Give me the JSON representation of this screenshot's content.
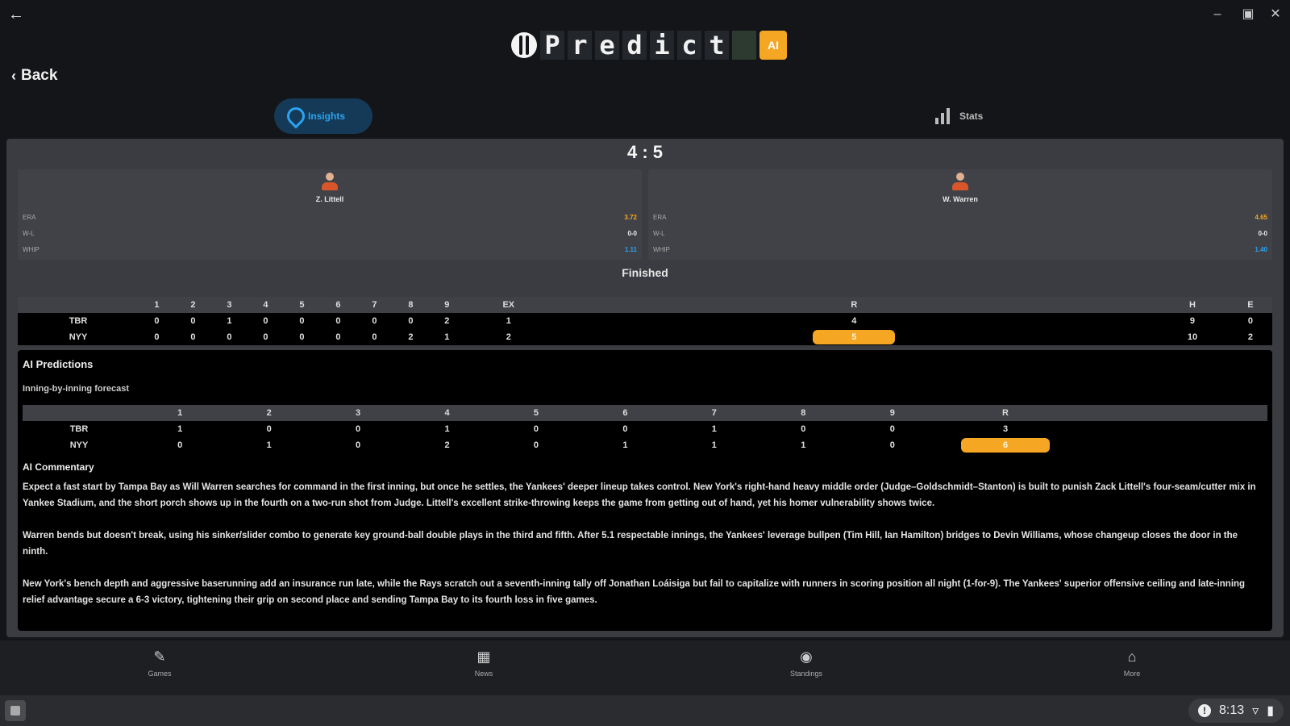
{
  "logo": {
    "letters": [
      "P",
      "r",
      "e",
      "d",
      "i",
      "c",
      "t"
    ],
    "ai_badge": "AI"
  },
  "nav": {
    "back_label": "Back"
  },
  "tabs": {
    "insights": "Insights",
    "stats": "Stats"
  },
  "game": {
    "score": "4 : 5",
    "status": "Finished",
    "away_pitcher": {
      "name": "Z. Littell",
      "stats": [
        {
          "k": "ERA",
          "v": "3.72"
        },
        {
          "k": "W-L",
          "v": "0-0"
        },
        {
          "k": "WHIP",
          "v": "1.11"
        }
      ]
    },
    "home_pitcher": {
      "name": "W. Warren",
      "stats": [
        {
          "k": "ERA",
          "v": "4.65"
        },
        {
          "k": "W-L",
          "v": "0-0"
        },
        {
          "k": "WHIP",
          "v": "1.40"
        }
      ]
    }
  },
  "boxscore": {
    "headers": [
      "",
      "1",
      "2",
      "3",
      "4",
      "5",
      "6",
      "7",
      "8",
      "9",
      "EX",
      "R",
      "H",
      "E"
    ],
    "rows": [
      {
        "team": "TBR",
        "cells": [
          "0",
          "0",
          "1",
          "0",
          "0",
          "0",
          "0",
          "0",
          "2",
          "1",
          "4",
          "9",
          "0"
        ]
      },
      {
        "team": "NYY",
        "cells": [
          "0",
          "0",
          "0",
          "0",
          "0",
          "0",
          "0",
          "2",
          "1",
          "2",
          "5",
          "10",
          "2"
        ]
      }
    ]
  },
  "ai": {
    "title": "AI Predictions",
    "subtitle": "Inning-by-inning forecast",
    "headers": [
      "",
      "1",
      "2",
      "3",
      "4",
      "5",
      "6",
      "7",
      "8",
      "9",
      "R"
    ],
    "rows": [
      {
        "team": "TBR",
        "cells": [
          "1",
          "0",
          "0",
          "1",
          "0",
          "0",
          "1",
          "0",
          "0",
          "3"
        ]
      },
      {
        "team": "NYY",
        "cells": [
          "0",
          "1",
          "0",
          "2",
          "0",
          "1",
          "1",
          "1",
          "0",
          "6"
        ]
      }
    ],
    "commentary_title": "AI Commentary",
    "paragraphs": [
      "Expect a fast start by Tampa Bay as Will Warren searches for command in the first inning, but once he settles, the Yankees' deeper lineup takes control. New York's right-hand heavy middle order (Judge–Goldschmidt–Stanton) is built to punish Zack Littell's four-seam/cutter mix in Yankee Stadium, and the short porch shows up in the fourth on a two-run shot from Judge. Littell's excellent strike-throwing keeps the game from getting out of hand, yet his homer vulnerability shows twice.",
      "Warren bends but doesn't break, using his sinker/slider combo to generate key ground-ball double plays in the third and fifth. After 5.1 respectable innings, the Yankees' leverage bullpen (Tim Hill, Ian Hamilton) bridges to Devin Williams, whose changeup closes the door in the ninth.",
      "New York's bench depth and aggressive baserunning add an insurance run late, while the Rays scratch out a seventh-inning tally off Jonathan Loáisiga but fail to capitalize with runners in scoring position all night (1-for-9). The Yankees' superior offensive ceiling and late-inning relief advantage secure a 6-3 victory, tightening their grip on second place and sending Tampa Bay to its fourth loss in five games."
    ]
  },
  "bottom_nav": [
    {
      "label": "Games",
      "icon": "bat-icon"
    },
    {
      "label": "News",
      "icon": "news-icon"
    },
    {
      "label": "Standings",
      "icon": "standings-icon"
    },
    {
      "label": "More",
      "icon": "more-icon"
    }
  ],
  "system": {
    "time": "8:13"
  },
  "colors": {
    "accent": "#2aa3f0",
    "highlight": "#f5a623"
  }
}
